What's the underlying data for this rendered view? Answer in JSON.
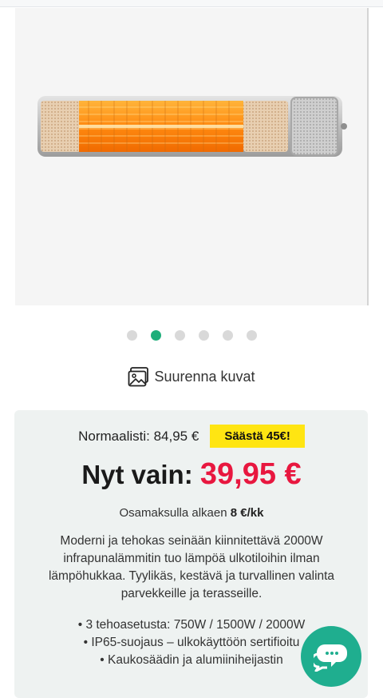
{
  "gallery": {
    "dots": [
      {
        "active": false
      },
      {
        "active": true
      },
      {
        "active": false
      },
      {
        "active": false
      },
      {
        "active": false
      },
      {
        "active": false
      }
    ],
    "zoom_label": "Suurenna kuvat"
  },
  "pricing": {
    "normal_label": "Normaalisti: 84,95 €",
    "save_badge": "Säästä 45€!",
    "now_label": "Nyt vain:",
    "price": "39,95 €",
    "installment_prefix": "Osamaksulla alkaen",
    "installment_amount": "8 €/kk"
  },
  "description": "Moderni ja tehokas seinään kiinnitettävä 2000W infrapunalämmitin tuo lämpöä ulkotiloihin ilman lämpöhukkaa. Tyylikäs, kestävä ja turvallinen valinta parvekkeille ja terasseille.",
  "features": [
    "3 tehoasetusta: 750W / 1500W / 2000W",
    "IP65-suojaus – ulkokäyttöön sertifioitu",
    "Kaukosäädin ja alumiiniheijastin"
  ],
  "colors": {
    "accent": "#1fae7a",
    "price": "#e8173f",
    "badge": "#ffe512",
    "chat": "#1fae8f"
  },
  "icons": {
    "zoom": "image-gallery-icon",
    "chat": "chat-bubbles-icon"
  }
}
